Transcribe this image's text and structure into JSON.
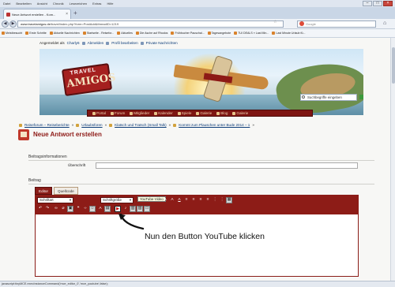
{
  "browser": {
    "menu": [
      "Datei",
      "Bearbeiten",
      "Ansicht",
      "Chronik",
      "Lesezeichen",
      "Extras",
      "Hilfe"
    ],
    "tab_title": "Neue Antwort erstellen - Kom...",
    "tab_close": "×",
    "new_tab": "+",
    "window_controls": [
      "–",
      "□",
      "×"
    ],
    "back": "◀",
    "forward": "▶",
    "url_host": "www.travelamigos.de",
    "url_path": "/travel/index.php?form=PostAdd&threadID=1219",
    "search_placeholder": "Google",
    "home": "⌂",
    "bookmarks": [
      "Meistbesucht",
      "Erste Schritte",
      "Aktuelle Nachrichten",
      "Startseite - Reisefor...",
      "Aktuelles",
      "Die Asche auf Rhodos",
      "Frühbucher Pauschal...",
      "Tagesangebote",
      "TUI DEALS » Last Min...",
      "Last Minute Urlaub fü..."
    ],
    "status": "javascript:tinyMCE.execInstanceCommand('mce_editor_0','mce_youtube',false);"
  },
  "user_bar": {
    "logged_in_as": "Angemeldet als",
    "user": "Charly6",
    "logout": "Abmelden",
    "edit_profile": "Profil bearbeiten",
    "private_messages": "Private Nachrichten"
  },
  "banner": {
    "logo_top": "TRAVEL",
    "logo_bottom": "AMIGOS",
    "search_placeholder": "Suchbegriffe eingeben"
  },
  "nav": [
    "Portal",
    "Forum",
    "Mitglieder",
    "Kalender",
    "Spiele",
    "Galerie",
    "Blog",
    "Galerie"
  ],
  "breadcrumb": [
    "Reiseforum – Reiseberichte",
    "Urlaubsforen",
    "Klatsch und Tratsch (Small Talk)",
    "Kommt zum Plauschen unter Bude 2014 – 1"
  ],
  "breadcrumb_sep": "»",
  "page_title": "Neue Antwort erstellen",
  "form": {
    "section_info": "Beitragsinformationen",
    "label_title": "Überschrift",
    "section_post": "Beitrag",
    "tab_editor": "Editor",
    "tab_source": "Quellcode",
    "font_select": "Schriftart",
    "size_select": "Schriftgröße",
    "tooltip": "YouTube-Video"
  },
  "annotation": "Nun den Button YouTube klicken",
  "colors": {
    "brand_red": "#8d1c17",
    "title_red": "#8e1b17",
    "link_blue": "#0b3b78"
  }
}
